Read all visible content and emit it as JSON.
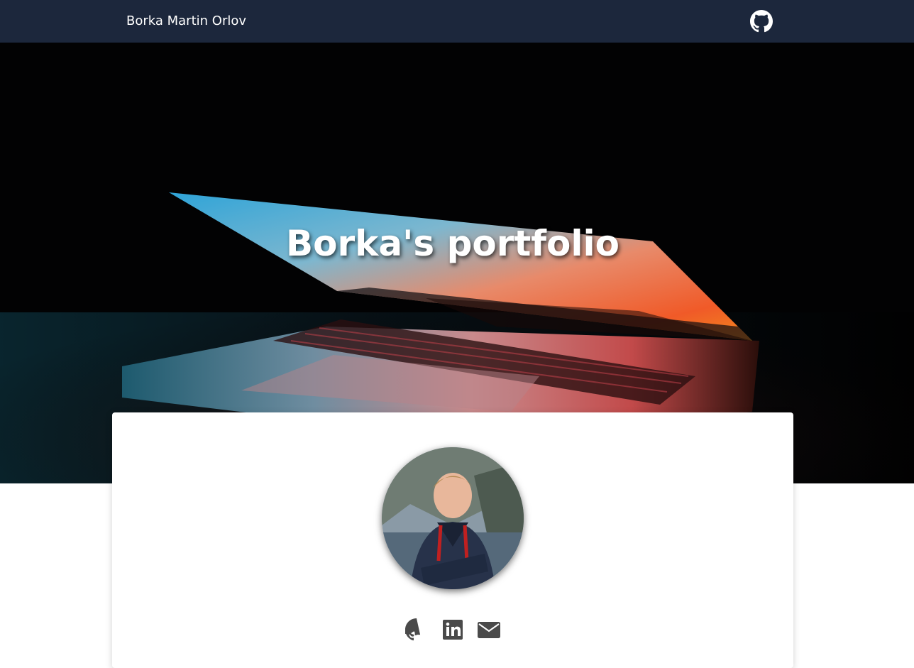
{
  "navbar": {
    "brand": "Borka Martin Orlov",
    "github_icon": "github-icon",
    "background": "#1c273c"
  },
  "hero": {
    "title": "Borka's portfolio",
    "background_image": "laptop-in-dark-photo"
  },
  "profile": {
    "avatar": "profile-photo",
    "social_links": [
      {
        "icon": "github-icon"
      },
      {
        "icon": "linkedin-icon"
      },
      {
        "icon": "envelope-icon"
      }
    ],
    "icon_color": "#4a4a4a"
  }
}
